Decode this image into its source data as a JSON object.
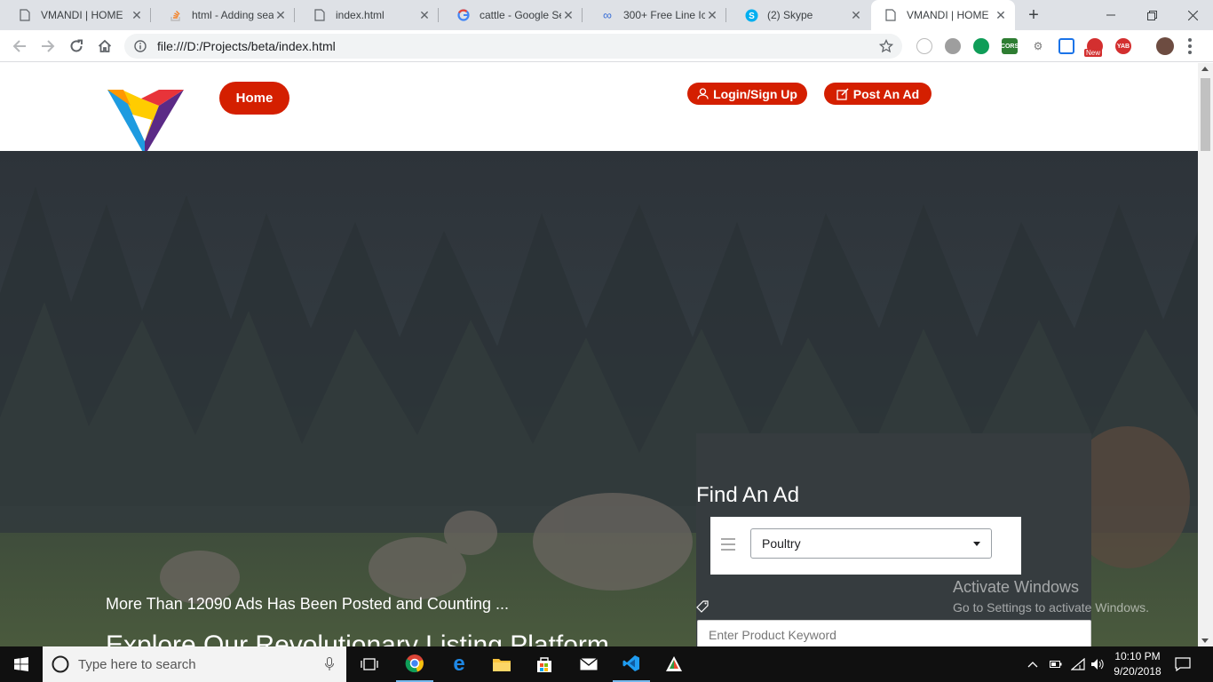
{
  "browser": {
    "tabs": [
      {
        "title": "VMANDI | HOME",
        "icon": "page-icon"
      },
      {
        "title": "html - Adding sea",
        "icon": "stackoverflow-icon"
      },
      {
        "title": "index.html",
        "icon": "page-icon"
      },
      {
        "title": "cattle - Google Se",
        "icon": "google-icon"
      },
      {
        "title": "300+ Free Line Ico",
        "icon": "infinity-icon"
      },
      {
        "title": "(2) Skype",
        "icon": "skype-icon"
      },
      {
        "title": "VMANDI | HOME",
        "icon": "page-icon",
        "active": true
      }
    ],
    "url": "file:///D:/Projects/beta/index.html",
    "extension_badges": {
      "new": "New",
      "cors": "CORS",
      "yab": "YAB"
    }
  },
  "header": {
    "home_label": "Home",
    "login_label": "Login/Sign Up",
    "post_label": "Post An Ad"
  },
  "hero": {
    "tagline": "More Than 12090 Ads Has Been Posted and Counting ...",
    "headline": "Explore Our Revolutionary Listing Platform"
  },
  "find": {
    "title": "Find An Ad",
    "category_selected": "Poultry",
    "keyword_placeholder": "Enter Product Keyword"
  },
  "watermark": {
    "line1": "Activate Windows",
    "line2": "Go to Settings to activate Windows."
  },
  "taskbar": {
    "search_placeholder": "Type here to search",
    "time": "10:10 PM",
    "date": "9/20/2018"
  },
  "colors": {
    "accent": "#d41f00",
    "panel": "#363c3f"
  }
}
